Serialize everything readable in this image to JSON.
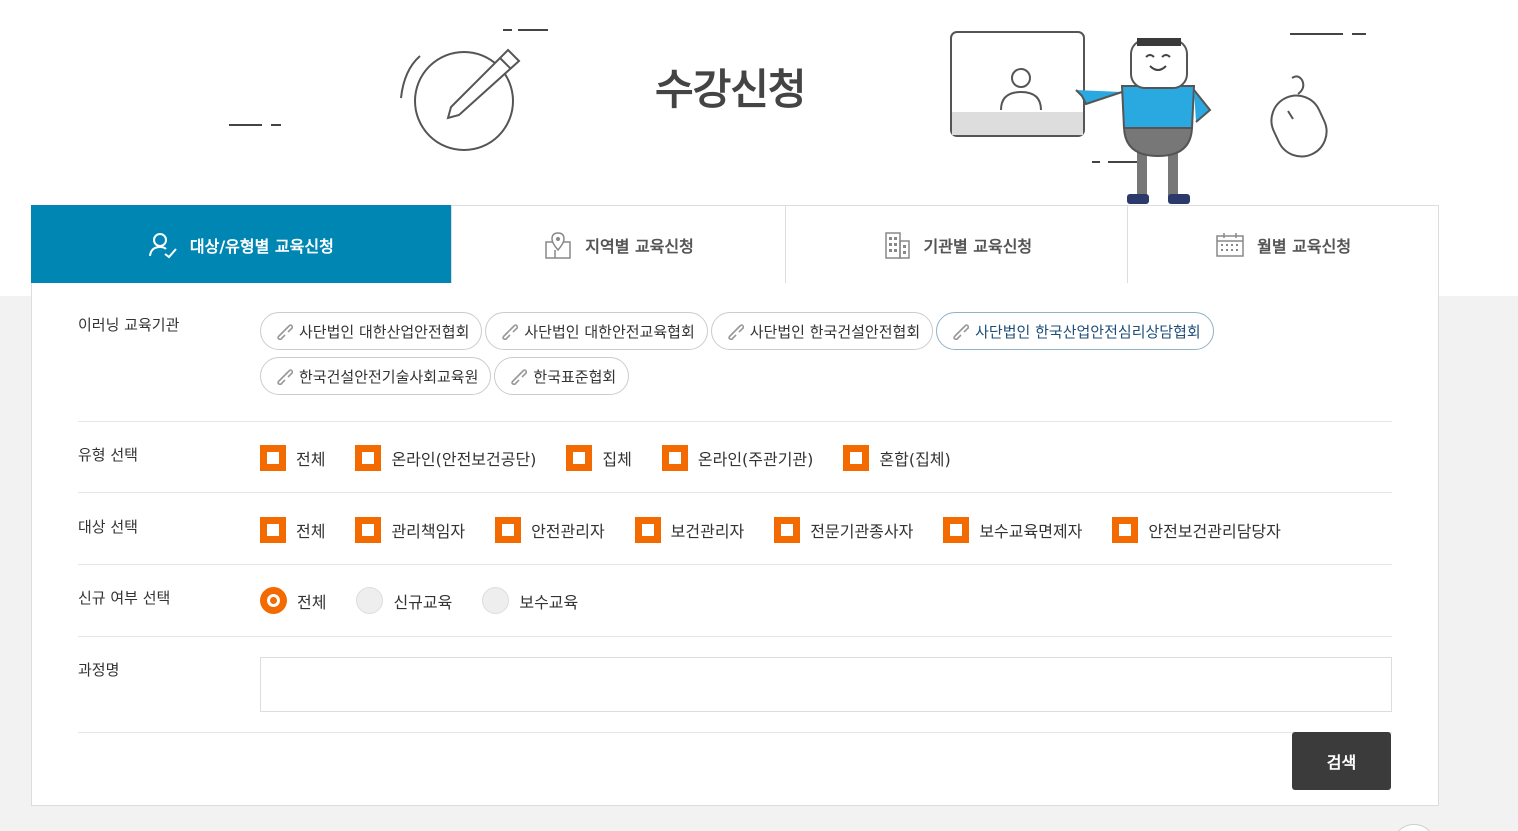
{
  "hero": {
    "title": "수강신청"
  },
  "tabs": [
    {
      "label": "대상/유형별 교육신청",
      "icon": "person-check-icon",
      "active": true
    },
    {
      "label": "지역별 교육신청",
      "icon": "map-pin-icon",
      "active": false
    },
    {
      "label": "기관별 교육신청",
      "icon": "building-icon",
      "active": false
    },
    {
      "label": "월별 교육신청",
      "icon": "calendar-icon",
      "active": false
    }
  ],
  "orgs": {
    "label": "이러닝 교육기관",
    "items": [
      "사단법인 대한산업안전협회",
      "사단법인 대한안전교육협회",
      "사단법인 한국건설안전협회",
      "사단법인 한국산업안전심리상담협회",
      "한국건설안전기술사회교육원",
      "한국표준협회"
    ],
    "selected_index": 3
  },
  "type_select": {
    "label": "유형 선택",
    "options": [
      "전체",
      "온라인(안전보건공단)",
      "집체",
      "온라인(주관기관)",
      "혼합(집체)"
    ]
  },
  "target_select": {
    "label": "대상 선택",
    "options": [
      "전체",
      "관리책임자",
      "안전관리자",
      "보건관리자",
      "전문기관종사자",
      "보수교육면제자",
      "안전보건관리담당자"
    ]
  },
  "new_select": {
    "label": "신규 여부 선택",
    "options": [
      "전체",
      "신규교육",
      "보수교육"
    ],
    "selected_index": 0
  },
  "course": {
    "label": "과정명",
    "value": ""
  },
  "search": {
    "label": "검색"
  },
  "colors": {
    "accent": "#f26a00",
    "tab_active": "#0086b3",
    "button": "#3b3b3b"
  }
}
